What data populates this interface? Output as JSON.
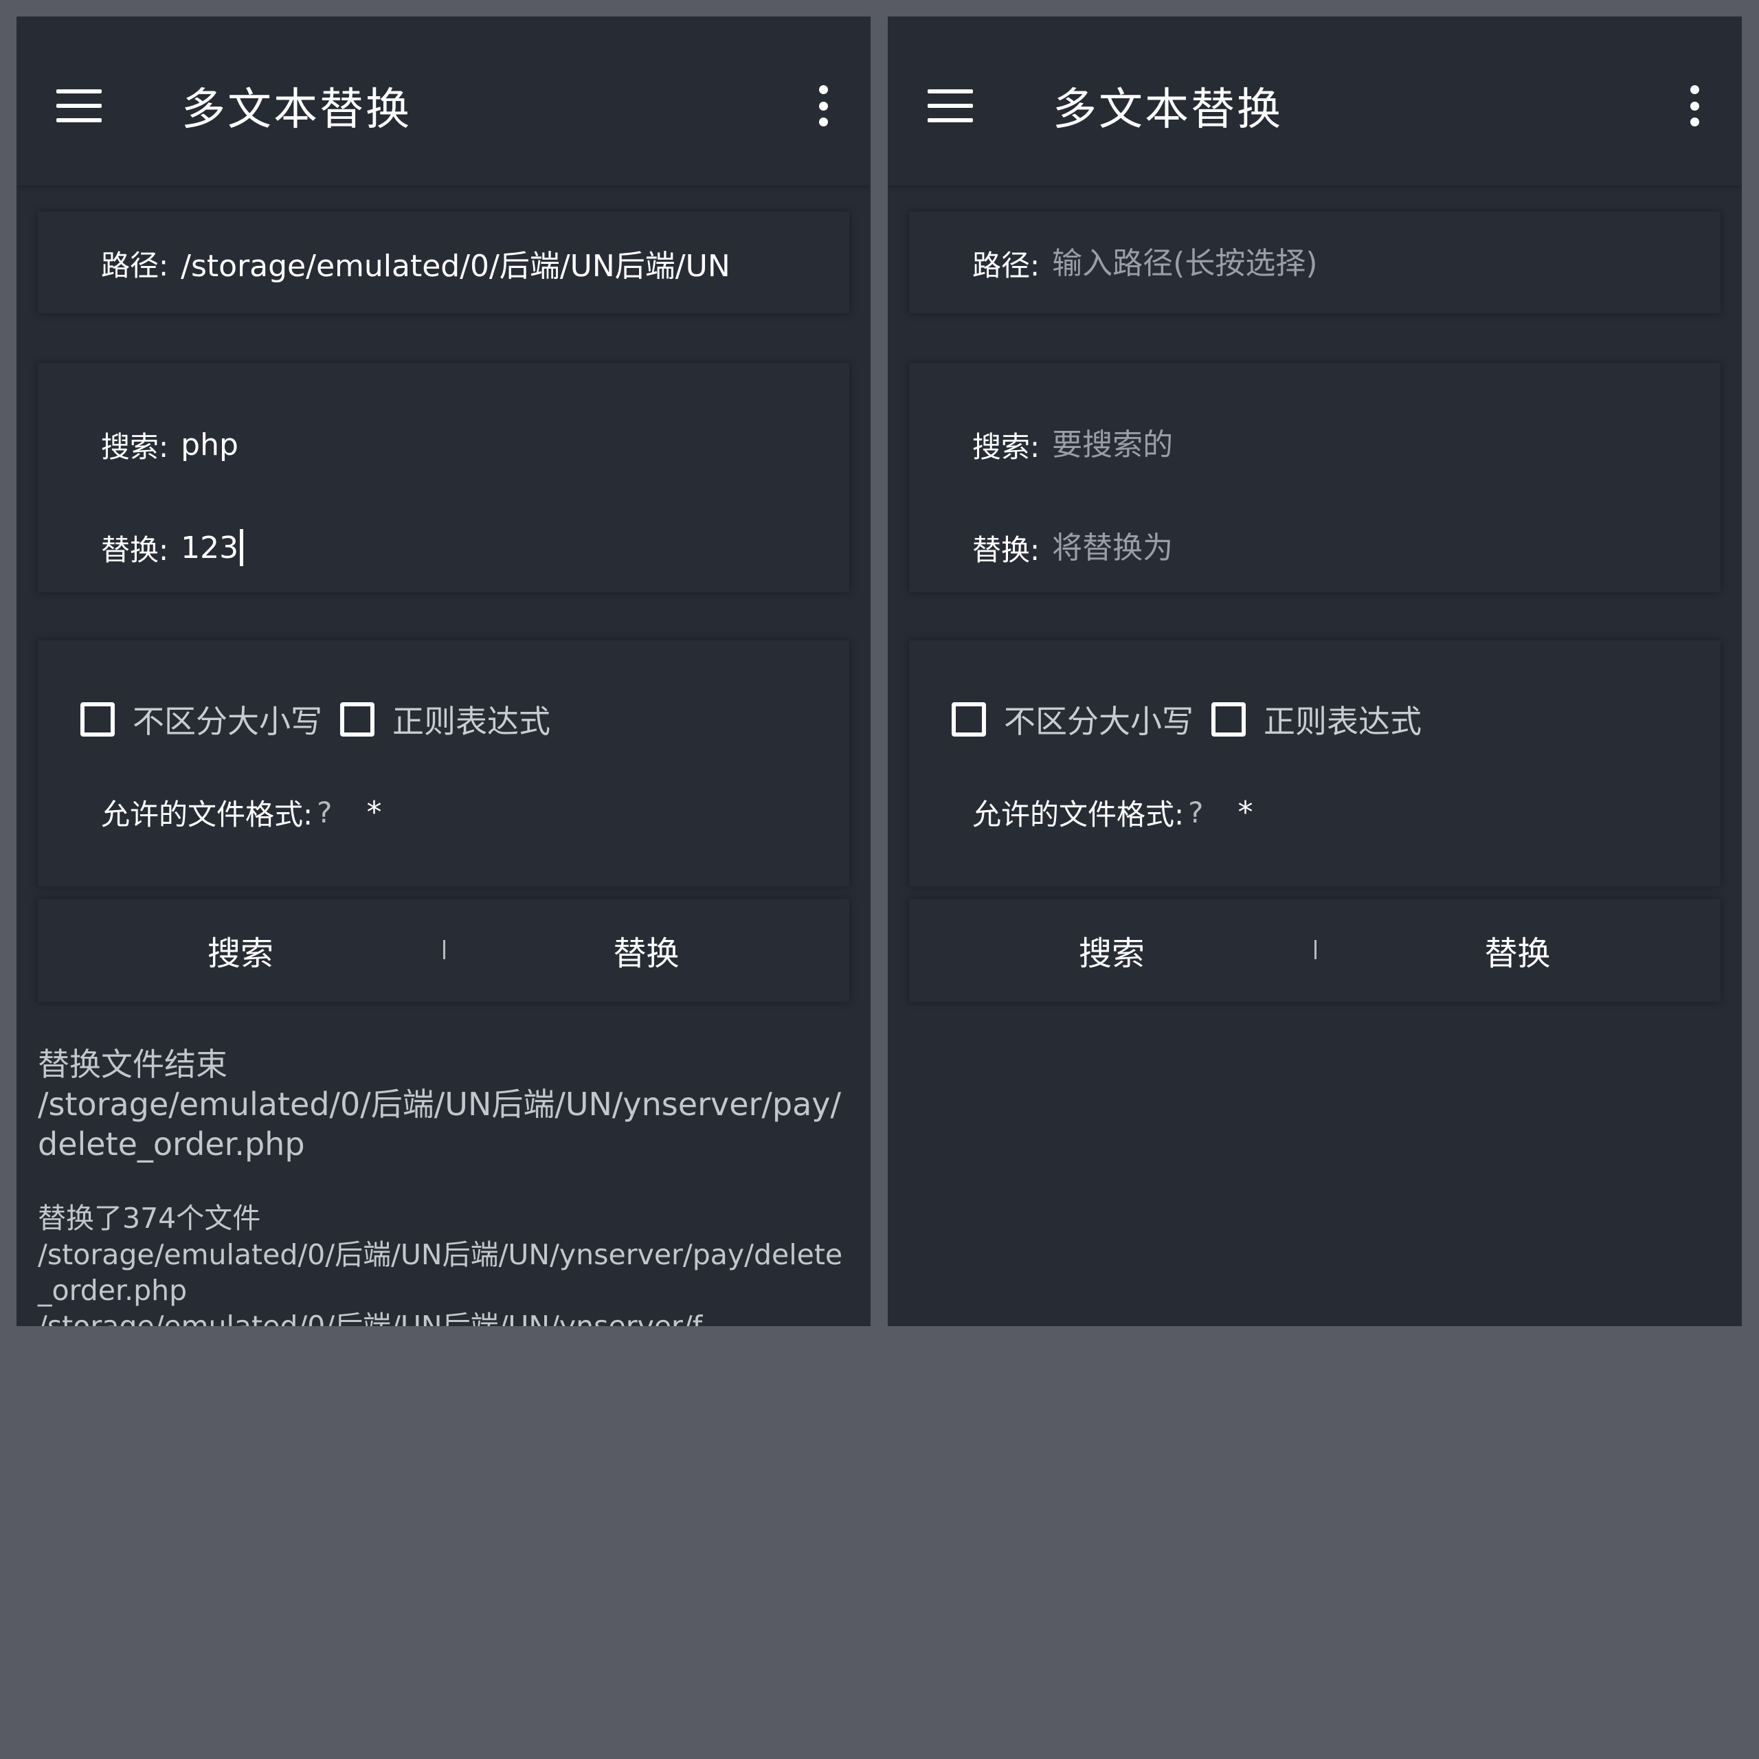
{
  "screens": [
    {
      "app_title": "多文本替换",
      "path": {
        "label": "路径:",
        "value": "/storage/emulated/0/后端/UN后端/UN",
        "placeholder": ""
      },
      "search": {
        "label": "搜索:",
        "value": "php",
        "placeholder": ""
      },
      "replace": {
        "label": "替换:",
        "value": "123",
        "placeholder": ""
      },
      "options": {
        "ignore_case_label": "不区分大小写",
        "regex_label": "正则表达式",
        "ignore_case_checked": false,
        "regex_checked": false
      },
      "file_format": {
        "label": "允许的文件格式:",
        "help": "?",
        "value": "*"
      },
      "actions": {
        "search_label": "搜索",
        "replace_label": "替换"
      },
      "log": [
        {
          "head": "替换文件结束",
          "body": "/storage/emulated/0/后端/UN后端/UN/ynserver/pay/delete_order.php"
        },
        {
          "head": "替换了374个文件",
          "body": "/storage/emulated/0/后端/UN后端/UN/ynserver/pay/delete_order.php\n/storage/emulated/0/后端/UN后端/UN/ynserver/f..."
        }
      ]
    },
    {
      "app_title": "多文本替换",
      "path": {
        "label": "路径:",
        "value": "",
        "placeholder": "输入路径(长按选择)"
      },
      "search": {
        "label": "搜索:",
        "value": "",
        "placeholder": "要搜索的"
      },
      "replace": {
        "label": "替换:",
        "value": "",
        "placeholder": "将替换为"
      },
      "options": {
        "ignore_case_label": "不区分大小写",
        "regex_label": "正则表达式",
        "ignore_case_checked": false,
        "regex_checked": false
      },
      "file_format": {
        "label": "允许的文件格式:",
        "help": "?",
        "value": "*"
      },
      "actions": {
        "search_label": "搜索",
        "replace_label": "替换"
      }
    }
  ],
  "colors": {
    "background": "#585b64",
    "screen": "#272b34",
    "card": "#282c35",
    "text": "#ffffff",
    "muted_text": "#c3c6cc",
    "placeholder": "#9a9ea6"
  }
}
